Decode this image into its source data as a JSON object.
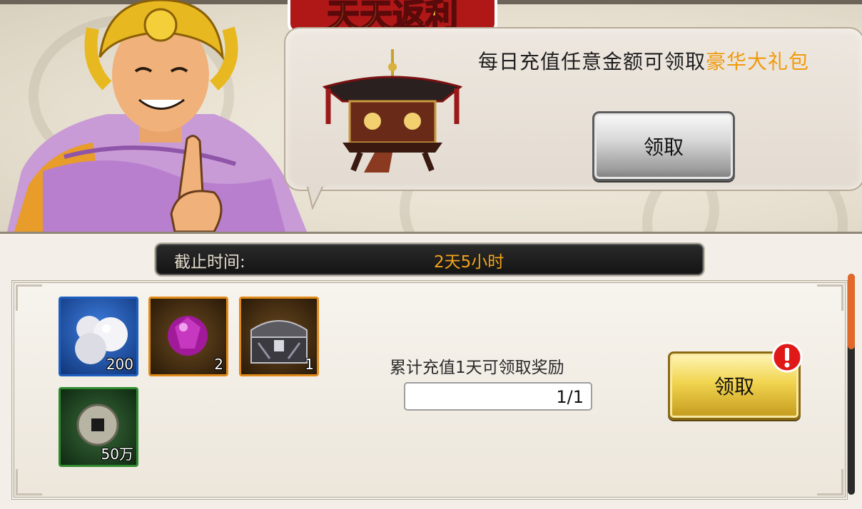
{
  "event_title": "天天返利",
  "bubble": {
    "message": "每日充值任意金额可领取",
    "highlight": "豪华大礼包",
    "claim_label": "领取"
  },
  "deadline": {
    "label": "截止时间:",
    "value": "2天5小时"
  },
  "reward": {
    "items": [
      {
        "name": "pearl-icon",
        "count": "200",
        "frame_color": "#1f5fc0"
      },
      {
        "name": "purple-gem-icon",
        "count": "2",
        "frame_color": "#e08a1a"
      },
      {
        "name": "treasure-chest-icon",
        "count": "1",
        "frame_color": "#e08a1a"
      },
      {
        "name": "copper-coin-icon",
        "count": "50万",
        "frame_color": "#2f8a2f"
      }
    ],
    "condition": "累计充值1天可领取奖励",
    "progress": "1/1",
    "claim_label": "领取"
  },
  "colors": {
    "highlight": "#f19a0a",
    "deadline_value": "#f2a41a",
    "scroll_thumb": "#e0682a"
  }
}
